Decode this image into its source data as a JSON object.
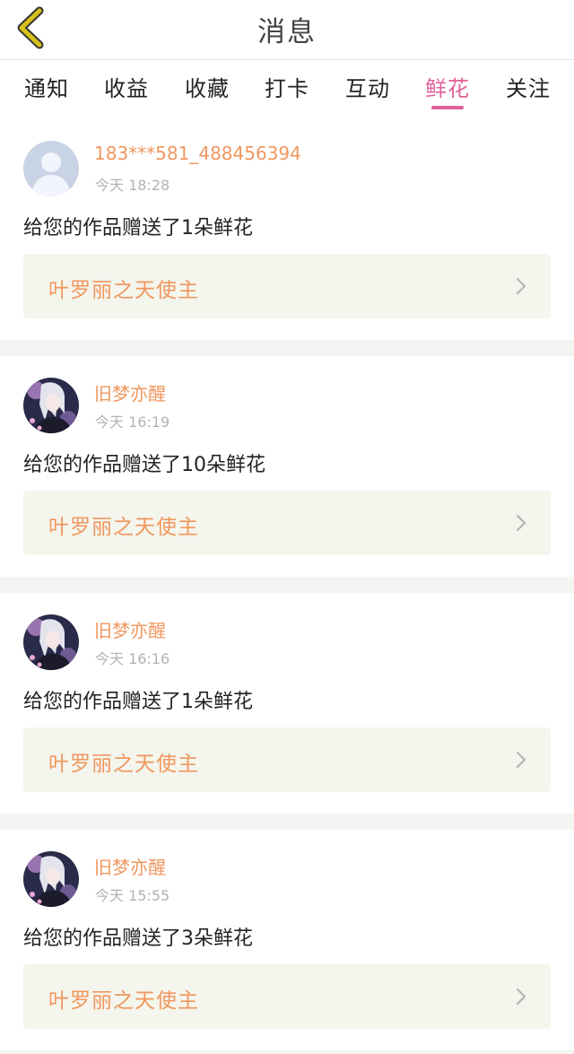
{
  "header": {
    "title": "消息",
    "back_icon": "chevron-left-icon",
    "back_icon_color": "#d8c01c"
  },
  "tabs": [
    {
      "label": "通知"
    },
    {
      "label": "收益"
    },
    {
      "label": "收藏"
    },
    {
      "label": "打卡"
    },
    {
      "label": "互动"
    },
    {
      "label": "鲜花",
      "active": true
    },
    {
      "label": "关注"
    }
  ],
  "accent_color": "#e0609a",
  "highlight_color": "#f0975f",
  "messages": [
    {
      "user": "183***581_488456394",
      "time": "今天 18:28",
      "text": "给您的作品赠送了1朵鲜花",
      "work": "叶罗丽之天使主",
      "avatar": "default-avatar"
    },
    {
      "user": "旧梦亦醒",
      "time": "今天 16:19",
      "text": "给您的作品赠送了10朵鲜花",
      "work": "叶罗丽之天使主",
      "avatar": "anime-avatar"
    },
    {
      "user": "旧梦亦醒",
      "time": "今天 16:16",
      "text": "给您的作品赠送了1朵鲜花",
      "work": "叶罗丽之天使主",
      "avatar": "anime-avatar"
    },
    {
      "user": "旧梦亦醒",
      "time": "今天 15:55",
      "text": "给您的作品赠送了3朵鲜花",
      "work": "叶罗丽之天使主",
      "avatar": "anime-avatar"
    }
  ]
}
